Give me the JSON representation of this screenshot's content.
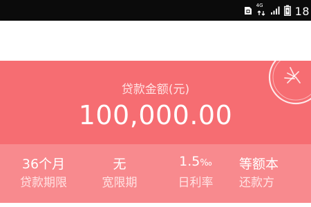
{
  "status_bar": {
    "network_label": "4G",
    "time": "18"
  },
  "loan": {
    "amount_label": "贷款金额(元)",
    "amount_value": "100,000.00"
  },
  "stats": [
    {
      "value": "36个月",
      "label": "贷款期限"
    },
    {
      "value": "无",
      "label": "宽限期"
    },
    {
      "value": "1.5",
      "value_suffix": "‰",
      "label": "日利率"
    },
    {
      "value": "等额本",
      "label": "还款方"
    }
  ],
  "colors": {
    "card_background": "#f66d72",
    "stats_background": "#f88a8e",
    "status_bar": "#0b0b0b"
  },
  "icons": {
    "status": [
      "sim-icon",
      "network-4g-icon",
      "signal-bars-icon",
      "battery-icon"
    ],
    "card": "stamp-seal-icon"
  }
}
